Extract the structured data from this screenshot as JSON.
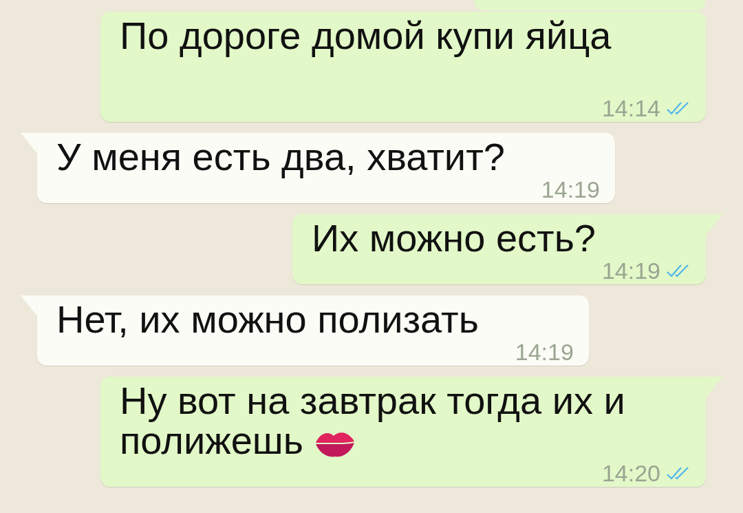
{
  "messages": [
    {
      "kind": "outgoing",
      "cut_off": true
    },
    {
      "kind": "outgoing",
      "tail": false,
      "text": "По дороге домой купи яйца",
      "time": "14:14",
      "read": true
    },
    {
      "kind": "incoming",
      "tail": true,
      "text": "У меня есть два, хватит?",
      "time": "14:19"
    },
    {
      "kind": "outgoing",
      "tail": true,
      "text": "Их можно есть?",
      "time": "14:19",
      "read": true
    },
    {
      "kind": "incoming",
      "tail": true,
      "text": "Нет, их можно полизать",
      "time": "14:19"
    },
    {
      "kind": "outgoing",
      "tail": true,
      "text": "Ну вот на завтрак тогда их и полижешь",
      "kiss_emoji": true,
      "time": "14:20",
      "read": true
    }
  ]
}
